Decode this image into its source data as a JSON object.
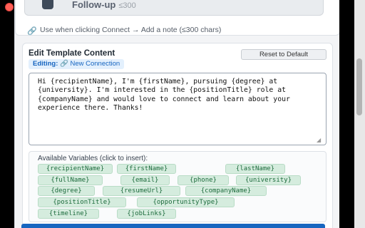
{
  "top_card": {
    "template_title": "Follow-up",
    "template_chars": "≤300",
    "usage_text": "Use when clicking Connect → Add a note (≤300 chars)"
  },
  "editor": {
    "title": "Edit Template Content",
    "reset_label": "Reset to Default",
    "editing_prefix": "Editing:",
    "editing_name": "🔗 New Connection",
    "template_text": "Hi {recipientName}, I'm {firstName}, pursuing {degree} at {university}. I'm interested in the {positionTitle} role at {companyName} and would love to connect and learn about your experience there. Thanks!"
  },
  "variables": {
    "label": "Available Variables (click to insert):",
    "chips": [
      "{recipientName}",
      "{firstName}",
      "{lastName}",
      "{fullName}",
      "{email}",
      "{phone}",
      "{university}",
      "{degree}",
      "{resumeUrl}",
      "{companyName}",
      "{positionTitle}",
      "{opportunityType}",
      "{timeline}",
      "{jobLinks}"
    ]
  },
  "colors": {
    "primary": "#1766c0",
    "chip_bg": "#d5ecde",
    "chip_text": "#1c6b3c",
    "badge_bg": "#e3f0fd"
  },
  "icons": {
    "link": "link-icon",
    "template": "template-icon",
    "close": "close-icon"
  }
}
